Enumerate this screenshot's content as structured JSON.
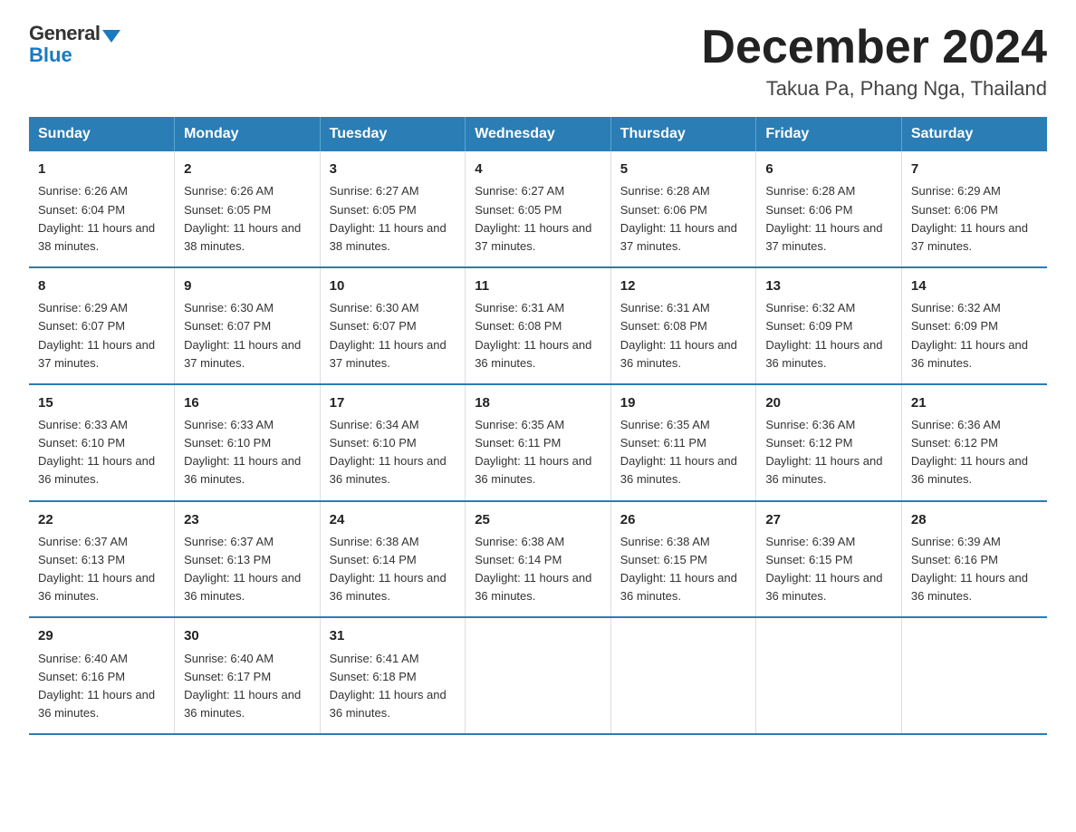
{
  "logo": {
    "general": "General",
    "blue": "Blue"
  },
  "header": {
    "month_year": "December 2024",
    "location": "Takua Pa, Phang Nga, Thailand"
  },
  "days_of_week": [
    "Sunday",
    "Monday",
    "Tuesday",
    "Wednesday",
    "Thursday",
    "Friday",
    "Saturday"
  ],
  "weeks": [
    [
      {
        "day": "1",
        "sunrise": "6:26 AM",
        "sunset": "6:04 PM",
        "daylight": "11 hours and 38 minutes."
      },
      {
        "day": "2",
        "sunrise": "6:26 AM",
        "sunset": "6:05 PM",
        "daylight": "11 hours and 38 minutes."
      },
      {
        "day": "3",
        "sunrise": "6:27 AM",
        "sunset": "6:05 PM",
        "daylight": "11 hours and 38 minutes."
      },
      {
        "day": "4",
        "sunrise": "6:27 AM",
        "sunset": "6:05 PM",
        "daylight": "11 hours and 37 minutes."
      },
      {
        "day": "5",
        "sunrise": "6:28 AM",
        "sunset": "6:06 PM",
        "daylight": "11 hours and 37 minutes."
      },
      {
        "day": "6",
        "sunrise": "6:28 AM",
        "sunset": "6:06 PM",
        "daylight": "11 hours and 37 minutes."
      },
      {
        "day": "7",
        "sunrise": "6:29 AM",
        "sunset": "6:06 PM",
        "daylight": "11 hours and 37 minutes."
      }
    ],
    [
      {
        "day": "8",
        "sunrise": "6:29 AM",
        "sunset": "6:07 PM",
        "daylight": "11 hours and 37 minutes."
      },
      {
        "day": "9",
        "sunrise": "6:30 AM",
        "sunset": "6:07 PM",
        "daylight": "11 hours and 37 minutes."
      },
      {
        "day": "10",
        "sunrise": "6:30 AM",
        "sunset": "6:07 PM",
        "daylight": "11 hours and 37 minutes."
      },
      {
        "day": "11",
        "sunrise": "6:31 AM",
        "sunset": "6:08 PM",
        "daylight": "11 hours and 36 minutes."
      },
      {
        "day": "12",
        "sunrise": "6:31 AM",
        "sunset": "6:08 PM",
        "daylight": "11 hours and 36 minutes."
      },
      {
        "day": "13",
        "sunrise": "6:32 AM",
        "sunset": "6:09 PM",
        "daylight": "11 hours and 36 minutes."
      },
      {
        "day": "14",
        "sunrise": "6:32 AM",
        "sunset": "6:09 PM",
        "daylight": "11 hours and 36 minutes."
      }
    ],
    [
      {
        "day": "15",
        "sunrise": "6:33 AM",
        "sunset": "6:10 PM",
        "daylight": "11 hours and 36 minutes."
      },
      {
        "day": "16",
        "sunrise": "6:33 AM",
        "sunset": "6:10 PM",
        "daylight": "11 hours and 36 minutes."
      },
      {
        "day": "17",
        "sunrise": "6:34 AM",
        "sunset": "6:10 PM",
        "daylight": "11 hours and 36 minutes."
      },
      {
        "day": "18",
        "sunrise": "6:35 AM",
        "sunset": "6:11 PM",
        "daylight": "11 hours and 36 minutes."
      },
      {
        "day": "19",
        "sunrise": "6:35 AM",
        "sunset": "6:11 PM",
        "daylight": "11 hours and 36 minutes."
      },
      {
        "day": "20",
        "sunrise": "6:36 AM",
        "sunset": "6:12 PM",
        "daylight": "11 hours and 36 minutes."
      },
      {
        "day": "21",
        "sunrise": "6:36 AM",
        "sunset": "6:12 PM",
        "daylight": "11 hours and 36 minutes."
      }
    ],
    [
      {
        "day": "22",
        "sunrise": "6:37 AM",
        "sunset": "6:13 PM",
        "daylight": "11 hours and 36 minutes."
      },
      {
        "day": "23",
        "sunrise": "6:37 AM",
        "sunset": "6:13 PM",
        "daylight": "11 hours and 36 minutes."
      },
      {
        "day": "24",
        "sunrise": "6:38 AM",
        "sunset": "6:14 PM",
        "daylight": "11 hours and 36 minutes."
      },
      {
        "day": "25",
        "sunrise": "6:38 AM",
        "sunset": "6:14 PM",
        "daylight": "11 hours and 36 minutes."
      },
      {
        "day": "26",
        "sunrise": "6:38 AM",
        "sunset": "6:15 PM",
        "daylight": "11 hours and 36 minutes."
      },
      {
        "day": "27",
        "sunrise": "6:39 AM",
        "sunset": "6:15 PM",
        "daylight": "11 hours and 36 minutes."
      },
      {
        "day": "28",
        "sunrise": "6:39 AM",
        "sunset": "6:16 PM",
        "daylight": "11 hours and 36 minutes."
      }
    ],
    [
      {
        "day": "29",
        "sunrise": "6:40 AM",
        "sunset": "6:16 PM",
        "daylight": "11 hours and 36 minutes."
      },
      {
        "day": "30",
        "sunrise": "6:40 AM",
        "sunset": "6:17 PM",
        "daylight": "11 hours and 36 minutes."
      },
      {
        "day": "31",
        "sunrise": "6:41 AM",
        "sunset": "6:18 PM",
        "daylight": "11 hours and 36 minutes."
      },
      null,
      null,
      null,
      null
    ]
  ]
}
